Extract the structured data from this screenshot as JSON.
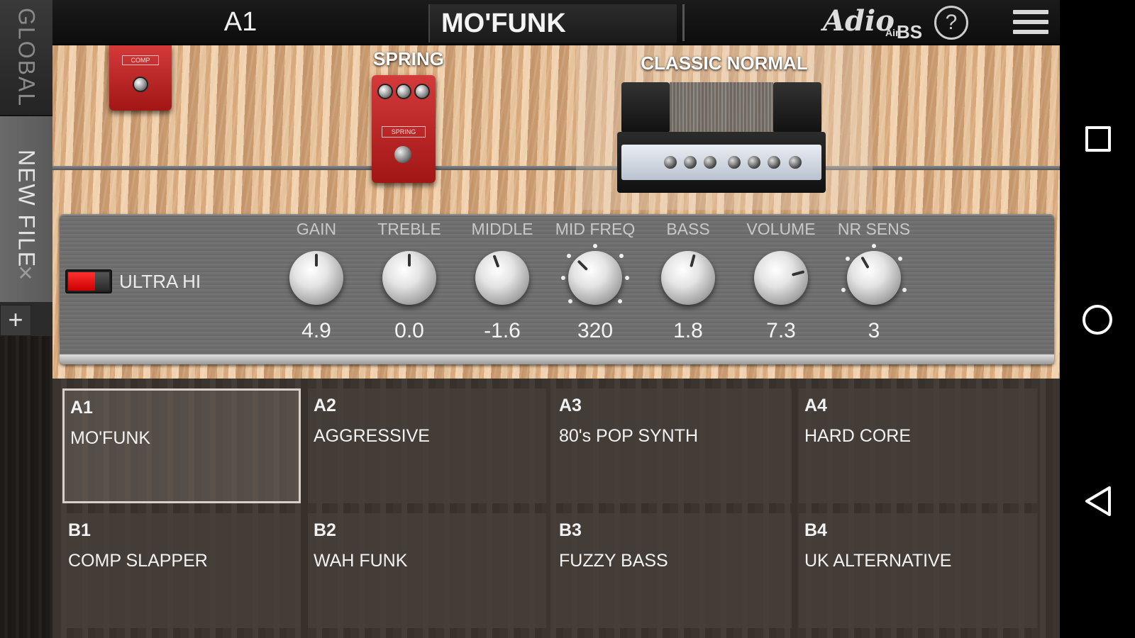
{
  "sidebar": {
    "global_label": "GLOBAL",
    "newfile_label": "NEW FILE",
    "close_glyph": "✕",
    "add_glyph": "+"
  },
  "topbar": {
    "preset_slot": "A1",
    "preset_name": "MO'FUNK",
    "logo_script": "Adio",
    "logo_small": "Air",
    "logo_bs": "BS",
    "help_glyph": "?"
  },
  "stage": {
    "pedal_comp_badge": "COMP",
    "pedal_spring_label": "SPRING",
    "pedal_spring_badge": "SPRING",
    "amp_name": "CLASSIC NORMAL"
  },
  "controls": {
    "mode_label": "ULTRA HI",
    "mode_on": true,
    "knobs": [
      {
        "label": "GAIN",
        "value": "4.9"
      },
      {
        "label": "TREBLE",
        "value": "0.0"
      },
      {
        "label": "MIDDLE",
        "value": "-1.6"
      },
      {
        "label": "MID FREQ",
        "value": "320"
      },
      {
        "label": "BASS",
        "value": "1.8"
      },
      {
        "label": "VOLUME",
        "value": "7.3"
      },
      {
        "label": "NR SENS",
        "value": "3"
      }
    ]
  },
  "presets": [
    {
      "slot": "A1",
      "name": "MO'FUNK",
      "active": true
    },
    {
      "slot": "A2",
      "name": "AGGRESSIVE",
      "active": false
    },
    {
      "slot": "A3",
      "name": "80's POP SYNTH",
      "active": false
    },
    {
      "slot": "A4",
      "name": "HARD CORE",
      "active": false
    },
    {
      "slot": "B1",
      "name": "COMP SLAPPER",
      "active": false
    },
    {
      "slot": "B2",
      "name": "WAH FUNK",
      "active": false
    },
    {
      "slot": "B3",
      "name": "FUZZY BASS",
      "active": false
    },
    {
      "slot": "B4",
      "name": "UK ALTERNATIVE",
      "active": false
    }
  ],
  "colors": {
    "toggle_on": "#e01010",
    "pedal_red": "#c02020"
  },
  "icons": {
    "help": "help-icon",
    "menu": "hamburger-menu-icon",
    "recents": "recents-square-icon",
    "home": "home-circle-icon",
    "back": "back-triangle-icon"
  }
}
